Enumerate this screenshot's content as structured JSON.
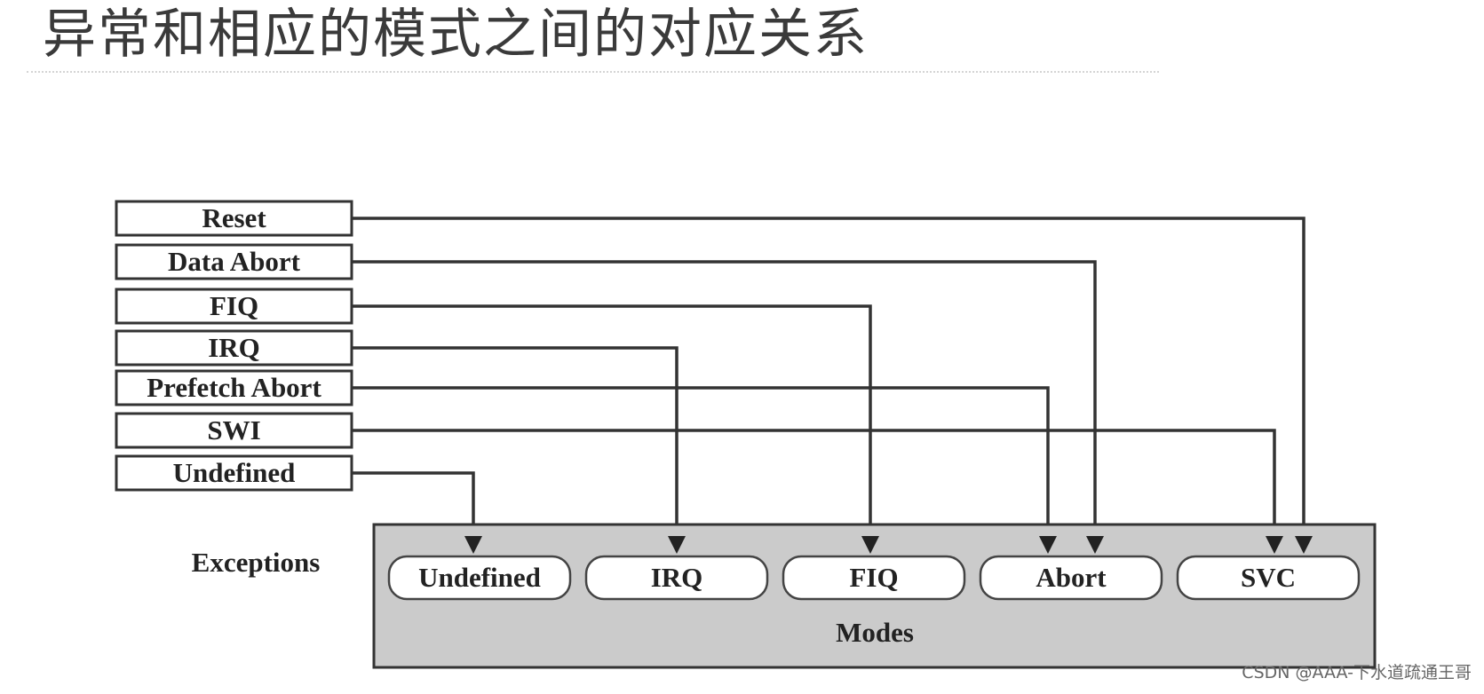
{
  "title": "异常和相应的模式之间的对应关系",
  "diagram": {
    "exceptions_label": "Exceptions",
    "modes_label": "Modes",
    "exceptions": [
      {
        "id": "reset",
        "label": "Reset",
        "target": "svc"
      },
      {
        "id": "data-abort",
        "label": "Data Abort",
        "target": "abort"
      },
      {
        "id": "fiq",
        "label": "FIQ",
        "target": "fiq"
      },
      {
        "id": "irq",
        "label": "IRQ",
        "target": "irq"
      },
      {
        "id": "prefetch-abort",
        "label": "Prefetch Abort",
        "target": "abort"
      },
      {
        "id": "swi",
        "label": "SWI",
        "target": "svc"
      },
      {
        "id": "undefined",
        "label": "Undefined",
        "target": "undefined"
      }
    ],
    "modes": [
      {
        "id": "undefined",
        "label": "Undefined"
      },
      {
        "id": "irq",
        "label": "IRQ"
      },
      {
        "id": "fiq",
        "label": "FIQ"
      },
      {
        "id": "abort",
        "label": "Abort"
      },
      {
        "id": "svc",
        "label": "SVC"
      }
    ]
  },
  "watermark": "CSDN @AAA-下水道疏通王哥"
}
